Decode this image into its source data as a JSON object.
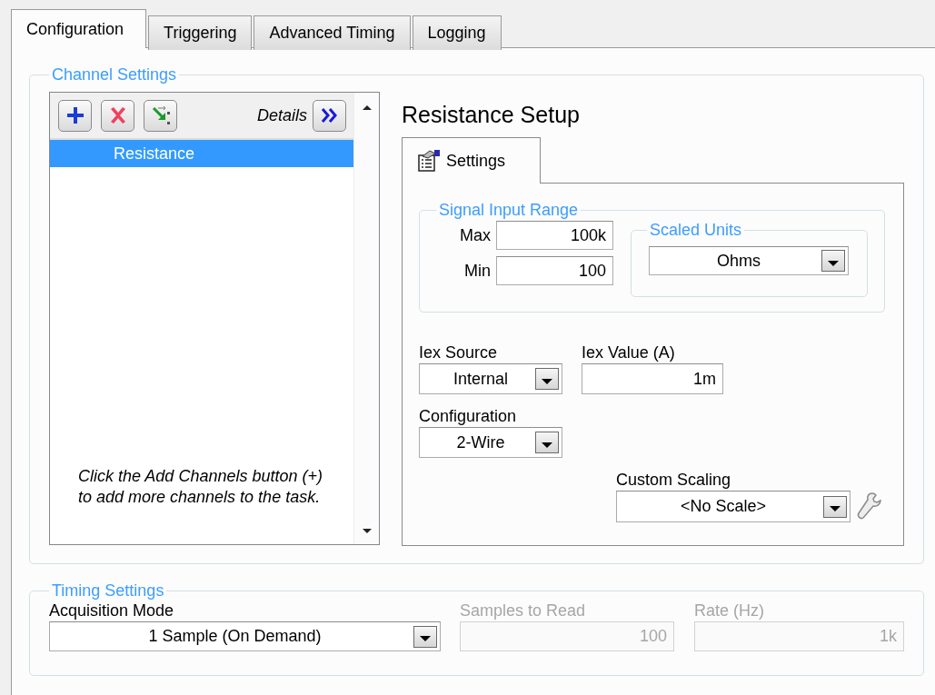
{
  "tabs": [
    {
      "label": "Configuration",
      "selected": true
    },
    {
      "label": "Triggering",
      "selected": false
    },
    {
      "label": "Advanced Timing",
      "selected": false
    },
    {
      "label": "Logging",
      "selected": false
    }
  ],
  "channel_settings": {
    "title": "Channel Settings",
    "details_label": "Details",
    "channels": [
      {
        "name": "Resistance",
        "selected": true
      }
    ],
    "hint": "Click the Add Channels button (+) to add more channels to the task.",
    "setup_title": "Resistance Setup",
    "setup_tabs": [
      {
        "label": "Settings",
        "selected": true
      }
    ],
    "signal_input_range": {
      "title": "Signal Input Range",
      "max": {
        "label": "Max",
        "value": "100k"
      },
      "min": {
        "label": "Min",
        "value": "100"
      }
    },
    "scaled_units": {
      "title": "Scaled Units",
      "value": "Ohms"
    },
    "iex_source": {
      "label": "Iex Source",
      "value": "Internal"
    },
    "iex_value": {
      "label": "Iex Value (A)",
      "value": "1m"
    },
    "configuration": {
      "label": "Configuration",
      "value": "2-Wire"
    },
    "custom_scaling": {
      "label": "Custom Scaling",
      "value": "<No Scale>"
    }
  },
  "timing_settings": {
    "title": "Timing Settings",
    "acquisition_mode": {
      "label": "Acquisition Mode",
      "value": "1 Sample (On Demand)"
    },
    "samples_to_read": {
      "label": "Samples to Read",
      "value": "100",
      "disabled": true
    },
    "rate": {
      "label": "Rate (Hz)",
      "value": "1k",
      "disabled": true
    }
  }
}
